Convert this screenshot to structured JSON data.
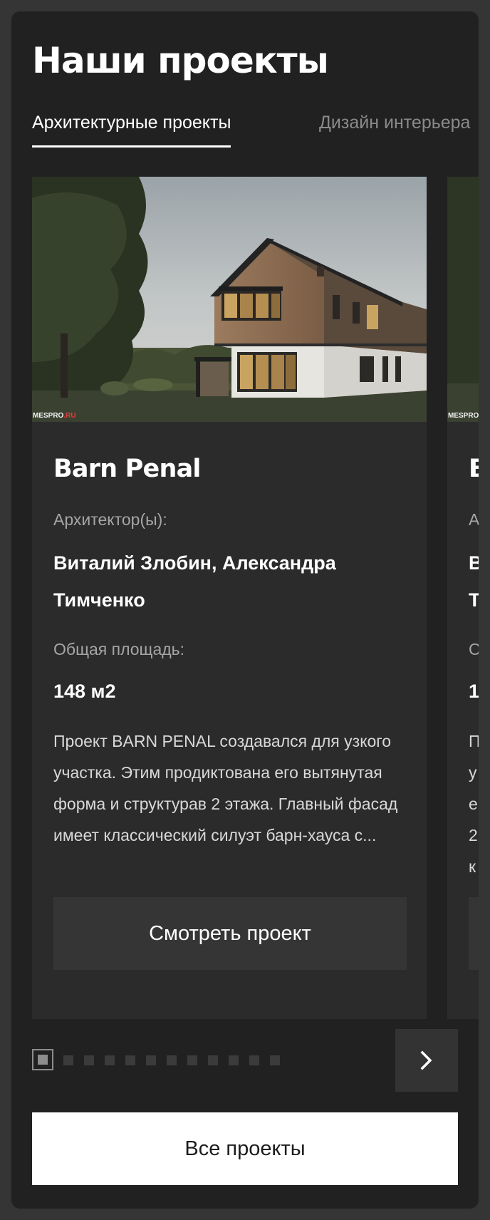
{
  "section": {
    "title": "Наши проекты"
  },
  "tabs": [
    {
      "label": "Архитектурные проекты",
      "active": true
    },
    {
      "label": "Дизайн интерьера",
      "active": false
    }
  ],
  "card": {
    "image_watermark_main": "MESPRO",
    "image_watermark_accent": ".RU",
    "name": "Barn Penal",
    "architects_label": "Архитектор(ы):",
    "architects_value": "Виталий Злобин, Александра Тимченко",
    "area_label": "Общая площадь:",
    "area_value": "148 м2",
    "description": "Проект BARN PENAL создавался для узкого участка. Этим продиктована его вытянутая форма и структурав 2 этажа. Главный фасад имеет классический силуэт барн-хауса с...",
    "view_button": "Смотреть проект"
  },
  "card_next": {
    "image_watermark_main": "MESPRO",
    "name_partial": "B",
    "architects_label_partial": "А",
    "architects_value_line1_partial": "В",
    "architects_value_line2_partial": "Т",
    "area_label_partial": "С",
    "area_value_partial": "1",
    "description_lines_partial": [
      "П",
      "у",
      "е",
      "2",
      "к"
    ]
  },
  "pagination": {
    "total": 12,
    "current": 1
  },
  "all_projects_button": "Все проекты",
  "colors": {
    "page_bg": "#353535",
    "panel_bg": "#212121",
    "card_bg": "#2b2b2b",
    "button_bg": "#353535",
    "accent_red": "#e43c3c"
  },
  "icons": {
    "next": "chevron-right-icon"
  }
}
